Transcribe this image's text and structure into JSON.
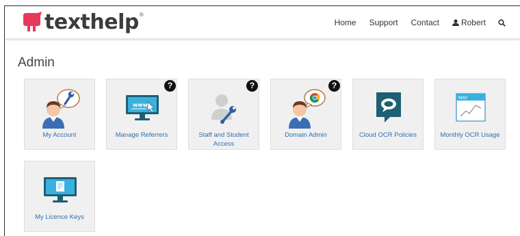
{
  "brand": {
    "name": "texthelp",
    "reg": "®"
  },
  "nav": {
    "home": "Home",
    "support": "Support",
    "contact": "Contact",
    "user": "Robert",
    "user_icon": "person-icon",
    "search_icon": "search-icon"
  },
  "page": {
    "title": "Admin"
  },
  "tiles": [
    {
      "label": "My Account",
      "icon": "user-wrench-icon"
    },
    {
      "label": "Manage Referrers",
      "icon": "monitor-www-icon",
      "help": "?"
    },
    {
      "label": "Staff and Student Access",
      "icon": "user-wrench-grey-icon",
      "help": "?"
    },
    {
      "label": "Domain Admin",
      "icon": "user-chrome-icon",
      "help": "?"
    },
    {
      "label": "Cloud OCR Policies",
      "icon": "speech-bubble-icon"
    },
    {
      "label": "Monthly OCR Usage",
      "icon": "calendar-chart-icon",
      "month": "MAY"
    },
    {
      "label": "My Licence Keys",
      "icon": "monitor-document-icon"
    }
  ],
  "colors": {
    "accent": "#e8385b",
    "link": "#2f6fb3",
    "tile_bg": "#f0f0f0",
    "teal": "#1d5f73"
  }
}
